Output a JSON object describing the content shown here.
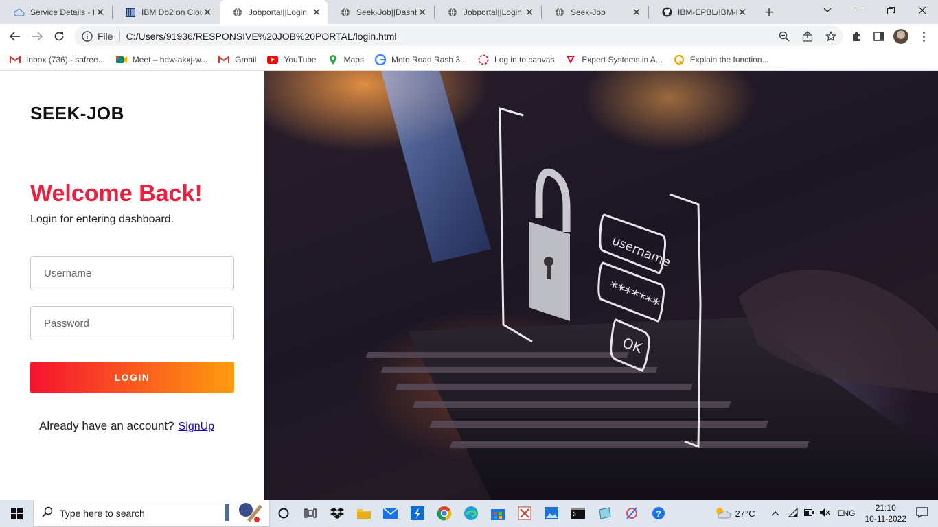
{
  "browser": {
    "tabs": [
      {
        "title": "Service Details - I",
        "icon": "cloud-icon",
        "active": false
      },
      {
        "title": "IBM Db2 on Clou",
        "icon": "ibm-grid-icon",
        "active": false
      },
      {
        "title": "Jobportal||Login",
        "icon": "globe-icon",
        "active": true
      },
      {
        "title": "Seek-Job||Dashb",
        "icon": "globe-icon",
        "active": false
      },
      {
        "title": "Jobportal||Login",
        "icon": "globe-icon",
        "active": false
      },
      {
        "title": "Seek-Job",
        "icon": "globe-icon",
        "active": false
      },
      {
        "title": "IBM-EPBL/IBM-P",
        "icon": "github-icon",
        "active": false
      }
    ],
    "omnibox": {
      "scheme_label": "File",
      "url": "C:/Users/91936/RESPONSIVE%20JOB%20PORTAL/login.html"
    },
    "bookmarks": [
      {
        "label": "Inbox (736) - safree...",
        "icon": "gmail-icon",
        "color": "#d93025"
      },
      {
        "label": "Meet – hdw-akxj-w...",
        "icon": "meet-icon",
        "color": "#00897b"
      },
      {
        "label": "Gmail",
        "icon": "gmail-icon",
        "color": "#d93025"
      },
      {
        "label": "YouTube",
        "icon": "youtube-icon",
        "color": "#ff0000"
      },
      {
        "label": "Maps",
        "icon": "maps-icon",
        "color": "#34a853"
      },
      {
        "label": "Moto Road Rash 3...",
        "icon": "g-icon",
        "color": "#4285f4"
      },
      {
        "label": "Log in to canvas",
        "icon": "canvas-icon",
        "color": "#e72429"
      },
      {
        "label": "Expert Systems in A...",
        "icon": "triangle-icon",
        "color": "#e4002b"
      },
      {
        "label": "Explain the function...",
        "icon": "quora-icon",
        "color": "#f0a500"
      }
    ]
  },
  "page": {
    "brand": "SEEK-JOB",
    "heading": "Welcome Back!",
    "subheading": "Login for entering dashboard.",
    "username_placeholder": "Username",
    "password_placeholder": "Password",
    "login_label": "LOGIN",
    "account_prompt": "Already have an account?",
    "signup_link": "SignUp",
    "accent_color": "#ee1f3f",
    "button_gradient": [
      "#f5132f",
      "#ff9c0f"
    ]
  },
  "taskbar": {
    "search_placeholder": "Type here to search",
    "weather": "27°C",
    "language": "ENG",
    "time": "21:10",
    "date": "10-11-2022"
  }
}
